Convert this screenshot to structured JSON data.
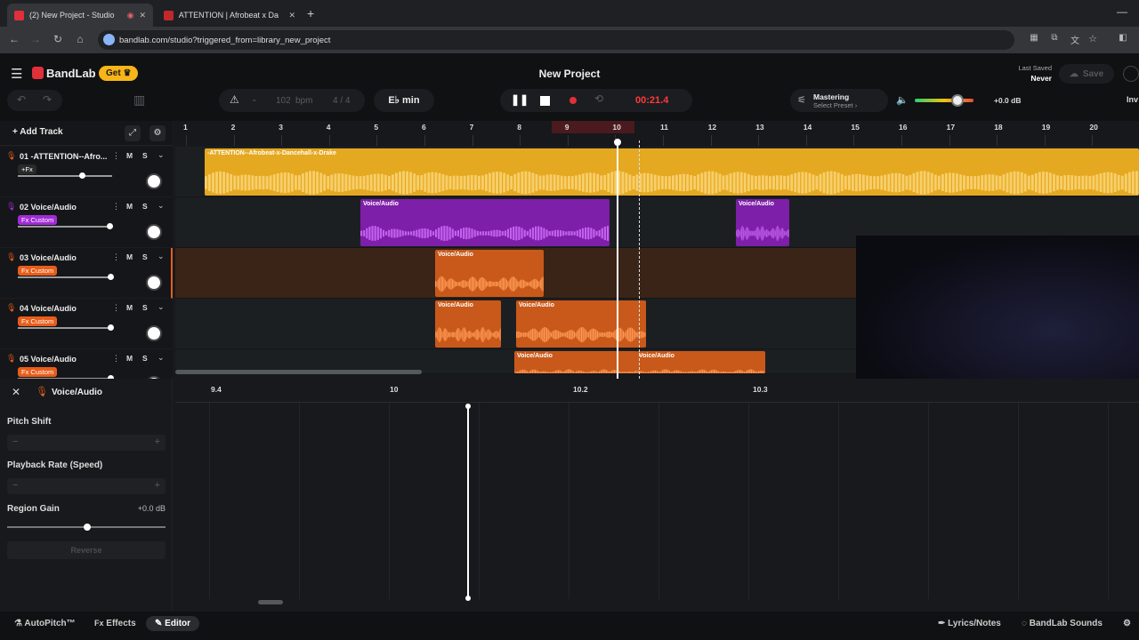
{
  "browser": {
    "tabs": [
      {
        "title": "(2) New Project - Studio",
        "active": true
      },
      {
        "title": "ATTENTION | Afrobeat x Da",
        "active": false
      }
    ],
    "url": "bandlab.com/studio?triggered_from=library_new_project"
  },
  "app": {
    "brand": "BandLab",
    "get_label": "Get",
    "project_title": "New Project",
    "last_saved_label": "Last Saved",
    "last_saved_value": "Never",
    "save_label": "Save",
    "invite_label": "Inv"
  },
  "transport": {
    "bpm": "102",
    "bpm_unit": "bpm",
    "time_signature": "4 / 4",
    "key": "E♭ min",
    "time": "00:21.4",
    "mastering_title": "Mastering",
    "mastering_preset": "Select Preset ›",
    "volume_db": "+0.0 dB",
    "volume_level": 0.72
  },
  "toolbar": {
    "add_track": "Add Track"
  },
  "ruler": [
    "1",
    "2",
    "3",
    "4",
    "5",
    "6",
    "7",
    "8",
    "9",
    "10",
    "11",
    "12",
    "13",
    "14",
    "15",
    "16",
    "17",
    "18",
    "19",
    "20"
  ],
  "tracks": [
    {
      "name": "01 -ATTENTION--Afro...",
      "badge": "+Fx",
      "badge_color": "#2a2a2a",
      "volume": 0.68,
      "mute": "M",
      "solo": "S"
    },
    {
      "name": "02 Voice/Audio",
      "badge": "Fx Custom",
      "badge_color": "#a32bd6",
      "volume": 0.97,
      "mute": "M",
      "solo": "S"
    },
    {
      "name": "03 Voice/Audio",
      "badge": "Fx Custom",
      "badge_color": "#e85d1a",
      "volume": 0.98,
      "mute": "M",
      "solo": "S"
    },
    {
      "name": "04 Voice/Audio",
      "badge": "Fx Custom",
      "badge_color": "#e85d1a",
      "volume": 0.98,
      "mute": "M",
      "solo": "S"
    },
    {
      "name": "05 Voice/Audio",
      "badge": "Fx Custom",
      "badge_color": "#e85d1a",
      "volume": 0.98,
      "mute": "M",
      "solo": "S"
    }
  ],
  "clips": {
    "main": "-ATTENTION--Afrobeat-x-Dancehall-x-Drake",
    "voice": "Voice/Audio"
  },
  "editor": {
    "track_label": "Voice/Audio",
    "ruler": [
      "9.4",
      "10",
      "10.2",
      "10.3"
    ],
    "pitch_shift_label": "Pitch Shift",
    "playback_rate_label": "Playback Rate (Speed)",
    "region_gain_label": "Region Gain",
    "region_gain_value": "+0.0 dB",
    "reverse_label": "Reverse"
  },
  "bottom": {
    "autopitch": "AutoPitch™",
    "effects_prefix": "Fx",
    "effects": "Effects",
    "editor": "Editor",
    "lyrics": "Lyrics/Notes",
    "sounds": "BandLab Sounds"
  }
}
